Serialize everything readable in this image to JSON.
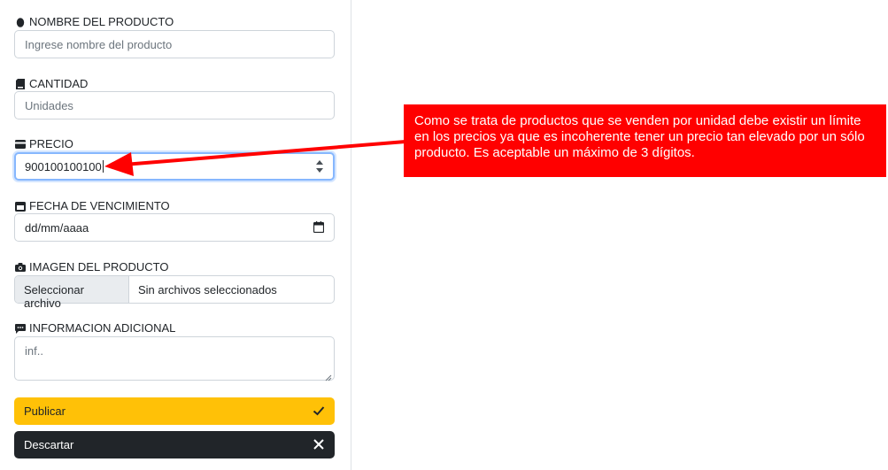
{
  "form": {
    "product_name": {
      "label": "NOMBRE DEL PRODUCTO",
      "icon": "egg-icon",
      "placeholder": "Ingrese nombre del producto"
    },
    "quantity": {
      "label": "CANTIDAD",
      "icon": "sd-card-icon",
      "placeholder": "Unidades"
    },
    "price": {
      "label": "PRECIO",
      "icon": "credit-card-icon",
      "value": "900100100100"
    },
    "expiry": {
      "label": "FECHA DE VENCIMIENTO",
      "icon": "calendar-icon",
      "placeholder": "dd/mm/aaaa"
    },
    "image": {
      "label": "IMAGEN DEL PRODUCTO",
      "icon": "camera-icon",
      "button": "Seleccionar archivo",
      "status": "Sin archivos seleccionados"
    },
    "info": {
      "label": "INFORMACION ADICIONAL",
      "icon": "chat-icon",
      "placeholder": "inf.."
    },
    "publish_label": "Publicar",
    "discard_label": "Descartar"
  },
  "annotation": {
    "text": "Como se trata de productos que se venden por unidad debe existir un límite en los precios ya que es incoherente tener un precio tan elevado por un sólo producto. Es aceptable un máximo de 3 dígitos.",
    "color": "#ff0000"
  },
  "colors": {
    "publish": "#ffc107",
    "discard": "#212529",
    "focus": "#86b7fe"
  }
}
